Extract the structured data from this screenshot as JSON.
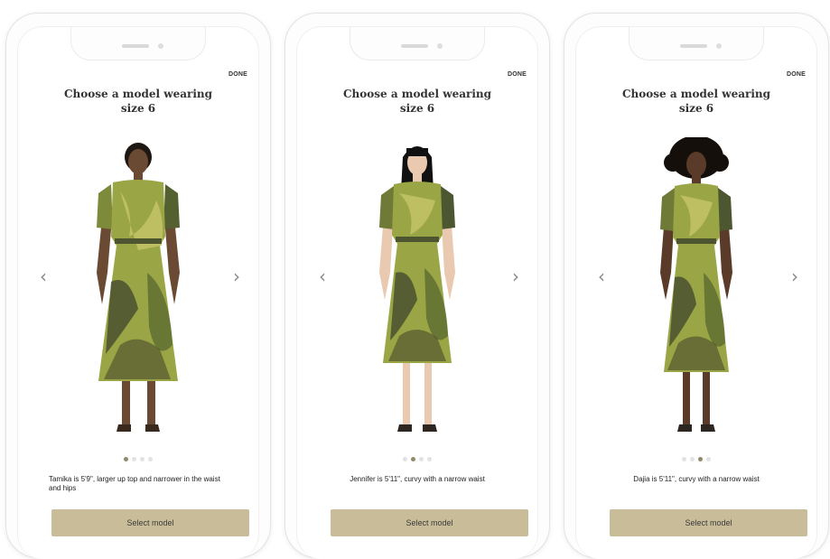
{
  "phones": [
    {
      "done_label": "DONE",
      "title_line1": "Choose a model wearing",
      "title_line2": "size 6",
      "prev_glyph": "‹",
      "next_glyph": "›",
      "active_dot": 1,
      "caption": "Tamika is 5'9\", larger up top and narrower in the waist and hips",
      "select_label": "Select model",
      "model": {
        "skin": "#6b4a33",
        "hair": "short-dark"
      }
    },
    {
      "done_label": "DONE",
      "title_line1": "Choose a model wearing",
      "title_line2": "size 6",
      "prev_glyph": "‹",
      "next_glyph": "›",
      "active_dot": 2,
      "caption": "Jennifer is 5'11\", curvy with a narrow waist",
      "select_label": "Select model",
      "model": {
        "skin": "#e9c9b0",
        "hair": "long-black-bangs"
      }
    },
    {
      "done_label": "DONE",
      "title_line1": "Choose a model wearing",
      "title_line2": "size 6",
      "prev_glyph": "‹",
      "next_glyph": "›",
      "active_dot": 3,
      "caption": "Dajia is 5'11\", curvy with a narrow waist",
      "select_label": "Select model",
      "model": {
        "skin": "#5a3a28",
        "hair": "curly-afro"
      }
    }
  ],
  "colors": {
    "button": "#c9bc99",
    "dot_active": "#8e8a6c",
    "dot_inactive": "#e2e2e2",
    "dress_green": "#9aa646",
    "dress_dark": "#3b3f2a"
  }
}
